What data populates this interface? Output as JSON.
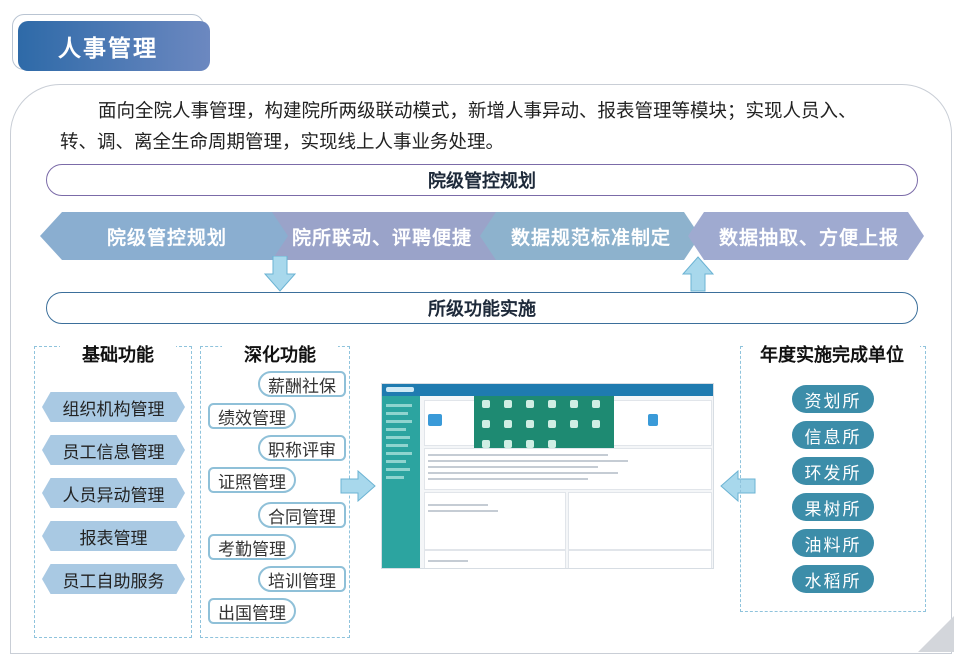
{
  "header": {
    "title": "人事管理"
  },
  "intro": "面向全院人事管理，构建院所两级联动模式，新增人事异动、报表管理等模块；实现人员入、转、调、离全生命周期管理，实现线上人事业务处理。",
  "institute_bar": {
    "label": "院级管控规划"
  },
  "chevrons": [
    {
      "label": "院级管控规划",
      "color": "#8aaed0"
    },
    {
      "label": "院所联动、评聘便捷",
      "color": "#9aa3c9"
    },
    {
      "label": "数据规范标准制定",
      "color": "#8db2cd"
    },
    {
      "label": "数据抽取、方便上报",
      "color": "#9faad0"
    }
  ],
  "institute_level_bar": {
    "label": "所级功能实施"
  },
  "basic": {
    "title": "基础功能",
    "items": [
      "组织机构管理",
      "员工信息管理",
      "人员异动管理",
      "报表管理",
      "员工自助服务"
    ]
  },
  "deep": {
    "title": "深化功能",
    "items": [
      "薪酬社保",
      "绩效管理",
      "职称评审",
      "证照管理",
      "合同管理",
      "考勤管理",
      "培训管理",
      "出国管理"
    ]
  },
  "units": {
    "title": "年度实施完成单位",
    "items": [
      "资划所",
      "信息所",
      "环发所",
      "果树所",
      "油料所",
      "水稻所"
    ]
  },
  "colors": {
    "header": "#2e6aa8",
    "unit": "#3c8da9",
    "arrow": "#a8d8ec",
    "pill_top": "#7b6ba8",
    "pill_bottom": "#3b6f9b"
  }
}
